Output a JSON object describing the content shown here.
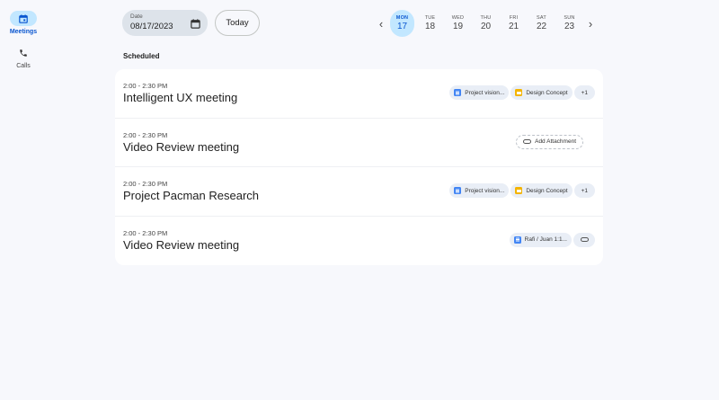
{
  "rail": [
    {
      "label": "Meetings",
      "icon": "calendar-icon",
      "active": true
    },
    {
      "label": "Calls",
      "icon": "phone-icon",
      "active": false
    }
  ],
  "date_field": {
    "caption": "Date",
    "value": "08/17/2023"
  },
  "today_label": "Today",
  "week": [
    {
      "dow": "MON",
      "date": "17"
    },
    {
      "dow": "TUE",
      "date": "18"
    },
    {
      "dow": "WED",
      "date": "19"
    },
    {
      "dow": "THU",
      "date": "20"
    },
    {
      "dow": "FRI",
      "date": "21"
    },
    {
      "dow": "SAT",
      "date": "22"
    },
    {
      "dow": "SUN",
      "date": "23"
    }
  ],
  "section_title": "Scheduled",
  "meetings": [
    {
      "time": "2:00 - 2:30 PM",
      "title": "Intelligent UX meeting",
      "doc_chip": "Project vision...",
      "slides_chip": "Design Concept",
      "more_chip": "+1"
    },
    {
      "time": "2:00 - 2:30 PM",
      "title": "Video Review meeting",
      "add_attachment": "Add Attachment"
    },
    {
      "time": "2:00 - 2:30 PM",
      "title": "Project Pacman Research",
      "doc_chip": "Project vision...",
      "slides_chip": "Design Concept",
      "more_chip": "+1"
    },
    {
      "time": "2:00 - 2:30 PM",
      "title": "Video Review meeting",
      "doc_chip": "Rafi / Juan 1:1..."
    }
  ],
  "colors": {
    "accent": "#0b57d0",
    "accent_container": "#c2e7ff",
    "doc": "#4285f4",
    "slides": "#f4b400"
  }
}
